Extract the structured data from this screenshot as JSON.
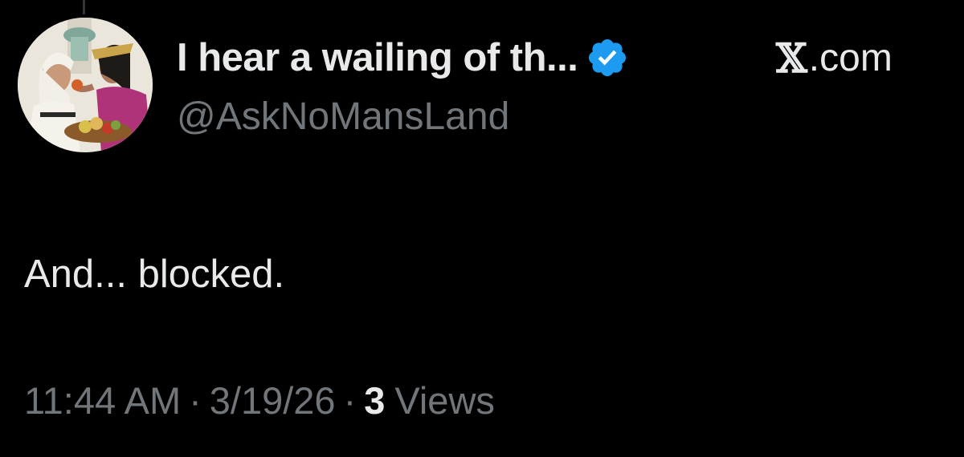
{
  "tweet": {
    "author": {
      "display_name": "I hear a wailing of th...",
      "handle": "@AskNoMansLand",
      "verified": true,
      "verified_icon": "verified-badge-icon",
      "avatar_icon": "profile-photo"
    },
    "site_label": {
      "logo_icon": "x-logo-icon",
      "logo_glyph": "𝕏",
      "text": ".com"
    },
    "text": "And... blocked.",
    "meta": {
      "time": "11:44 AM",
      "separator": "·",
      "date": "3/19/26",
      "views_count": "3",
      "views_label": "Views"
    }
  },
  "colors": {
    "background": "#000000",
    "primary_text": "#e7e9ea",
    "secondary_text": "#71767b",
    "verified_blue": "#1d9bf0"
  }
}
